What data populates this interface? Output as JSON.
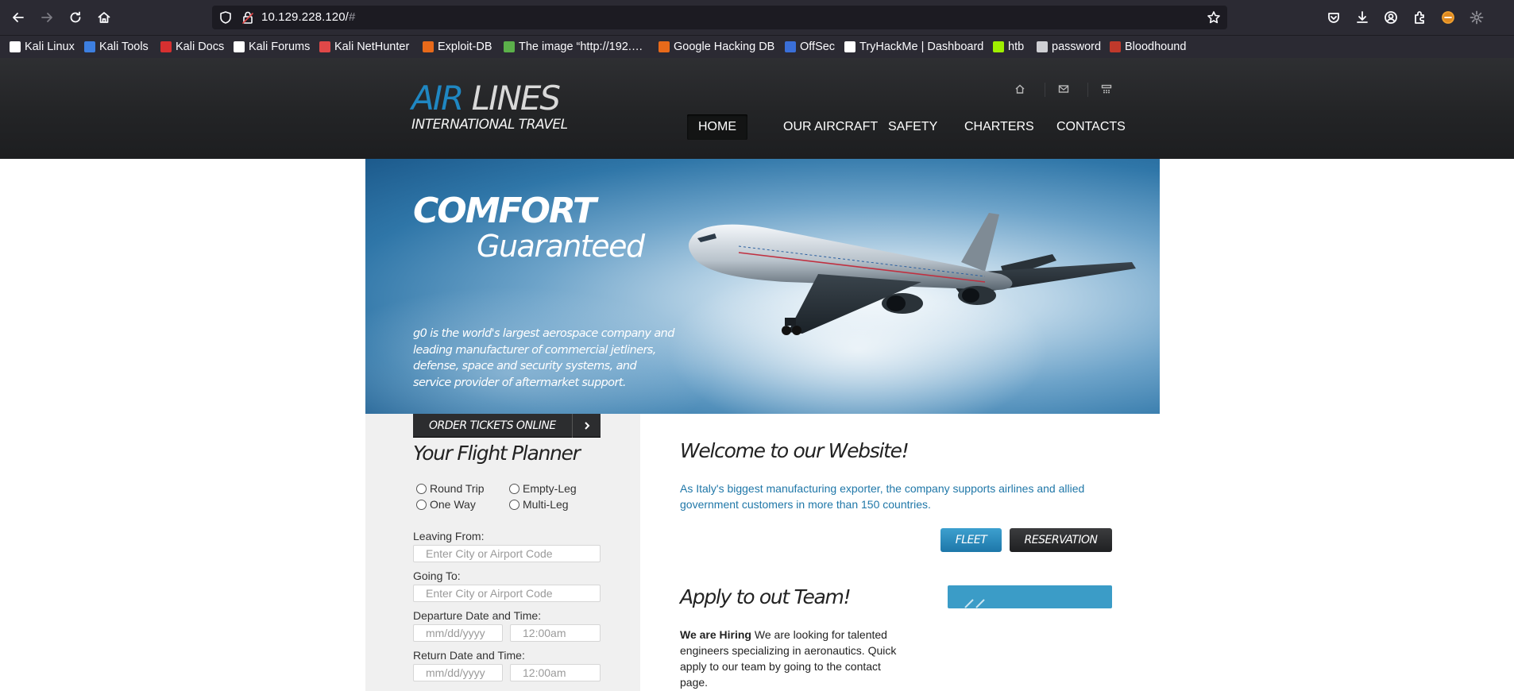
{
  "browser": {
    "url": "10.129.228.120/",
    "url_hash": "#",
    "bookmarks": [
      {
        "label": "Kali Linux",
        "icon": "kali-dragon-icon",
        "color": "#ffffff"
      },
      {
        "label": "Kali Tools",
        "icon": "kali-tools-icon",
        "color": "#3d7fe0"
      },
      {
        "label": "Kali Docs",
        "icon": "kali-docs-icon",
        "color": "#d63030"
      },
      {
        "label": "Kali Forums",
        "icon": "kali-dragon-icon",
        "color": "#ffffff"
      },
      {
        "label": "Kali NetHunter",
        "icon": "nethunter-icon",
        "color": "#e04848"
      },
      {
        "label": "Exploit-DB",
        "icon": "exploit-db-icon",
        "color": "#e86a1a"
      },
      {
        "label": "The image “http://192.…",
        "icon": "image-icon",
        "color": "#5bb04a"
      },
      {
        "label": "Google Hacking DB",
        "icon": "ghdb-icon",
        "color": "#e86a1a"
      },
      {
        "label": "OffSec",
        "icon": "offsec-icon",
        "color": "#3a6fd8"
      },
      {
        "label": "TryHackMe | Dashboard",
        "icon": "tryhackme-icon",
        "color": "#ffffff"
      },
      {
        "label": "htb",
        "icon": "htb-cube-icon",
        "color": "#9fef00"
      },
      {
        "label": "password",
        "icon": "globe-icon",
        "color": "#cfcfd4"
      },
      {
        "label": "Bloodhound",
        "icon": "bloodhound-icon",
        "color": "#c0392b"
      }
    ]
  },
  "site": {
    "logo_air": "AIR",
    "logo_lines": "LINES",
    "logo_sub": "INTERNATIONAL TRAVEL",
    "nav": [
      "HOME",
      "OUR AIRCRAFT",
      "SAFETY",
      "CHARTERS",
      "CONTACTS"
    ],
    "nav_active": "HOME",
    "header_icons": [
      "home-icon",
      "mail-icon",
      "sitemap-icon"
    ]
  },
  "hero": {
    "title1": "COMFORT",
    "title2": "Guaranteed",
    "description": "g0 is the world's largest aerospace company and leading manufacturer of commercial jetliners, defense, space and security systems, and service provider of aftermarket support."
  },
  "planner": {
    "order_button": "ORDER TICKETS ONLINE",
    "title": "Your Flight Planner",
    "trip_types": [
      "Round Trip",
      "Empty-Leg",
      "One Way",
      "Multi-Leg"
    ],
    "leaving_label": "Leaving From:",
    "leaving_placeholder": "Enter City or Airport Code",
    "going_label": "Going To:",
    "going_placeholder": "Enter City or Airport Code",
    "departure_label": "Departure Date and Time:",
    "return_label": "Return Date and Time:",
    "date_placeholder": "mm/dd/yyyy",
    "time_placeholder": "12:00am"
  },
  "main": {
    "welcome_title": "Welcome to our Website!",
    "welcome_text": "As Italy's biggest manufacturing exporter, the company supports airlines and allied government customers in more than 150 countries.",
    "fleet_button": "FLEET",
    "reservation_button": "RESERVATION",
    "apply_title": "Apply to out Team!",
    "hiring_bold": "We are Hiring",
    "hiring_text": " We are looking for talented engineers specializing in aeronautics. Quick apply to our team by going to the contact page."
  },
  "colors": {
    "brand_blue": "#1f87c2",
    "link_blue": "#1f77a8",
    "header_dark": "#232426"
  }
}
